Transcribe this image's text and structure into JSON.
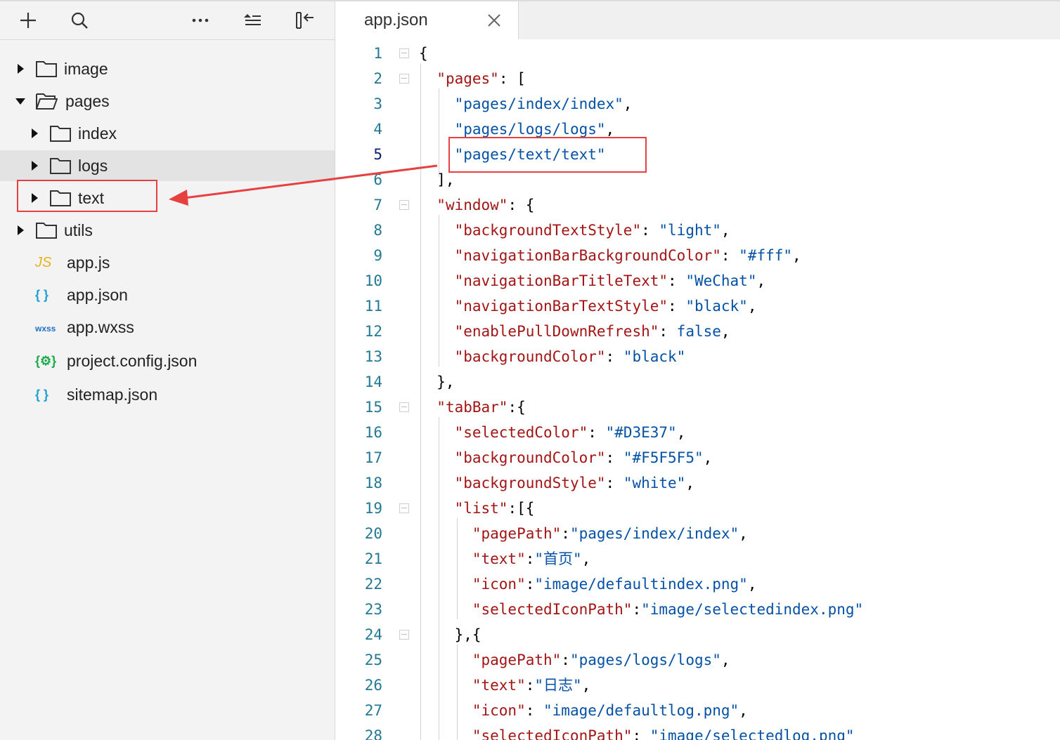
{
  "toolbar": {
    "icons": [
      "add-icon",
      "search-icon",
      "more-icon",
      "outline-icon",
      "collapse-icon"
    ]
  },
  "file_tree": [
    {
      "label": "image",
      "type": "folder",
      "expanded": false
    },
    {
      "label": "pages",
      "type": "folder",
      "expanded": true
    },
    {
      "label": "index",
      "type": "folder",
      "expanded": false
    },
    {
      "label": "logs",
      "type": "folder",
      "expanded": false,
      "selected": true
    },
    {
      "label": "text",
      "type": "folder",
      "expanded": false,
      "highlighted": true
    },
    {
      "label": "utils",
      "type": "folder",
      "expanded": false
    },
    {
      "label": "app.js",
      "type": "file",
      "badge": "JS",
      "badge_color": "#e8b21a"
    },
    {
      "label": "app.json",
      "type": "file",
      "badge": "{ }",
      "badge_color": "#1ea0d6"
    },
    {
      "label": "app.wxss",
      "type": "file",
      "badge": "wxss",
      "badge_color": "#1f6fc2"
    },
    {
      "label": "project.config.json",
      "type": "file",
      "badge": "{⚙}",
      "badge_color": "#1aab4a"
    },
    {
      "label": "sitemap.json",
      "type": "file",
      "badge": "{ }",
      "badge_color": "#1ea0d6"
    }
  ],
  "editor": {
    "tab_label": "app.json",
    "current_line": 5,
    "lines": [
      {
        "n": "1",
        "text": "{"
      },
      {
        "n": "2",
        "text": "  \"pages\": ["
      },
      {
        "n": "3",
        "text": "    \"pages/index/index\","
      },
      {
        "n": "4",
        "text": "    \"pages/logs/logs\","
      },
      {
        "n": "5",
        "text": "    \"pages/text/text\""
      },
      {
        "n": "6",
        "text": "  ],"
      },
      {
        "n": "7",
        "text": "  \"window\": {"
      },
      {
        "n": "8",
        "text": "    \"backgroundTextStyle\": \"light\","
      },
      {
        "n": "9",
        "text": "    \"navigationBarBackgroundColor\": \"#fff\","
      },
      {
        "n": "10",
        "text": "    \"navigationBarTitleText\": \"WeChat\","
      },
      {
        "n": "11",
        "text": "    \"navigationBarTextStyle\": \"black\","
      },
      {
        "n": "12",
        "text": "    \"enablePullDownRefresh\": false,"
      },
      {
        "n": "13",
        "text": "    \"backgroundColor\": \"black\""
      },
      {
        "n": "14",
        "text": "  },"
      },
      {
        "n": "15",
        "text": "  \"tabBar\":{"
      },
      {
        "n": "16",
        "text": "    \"selectedColor\": \"#D3E37\","
      },
      {
        "n": "17",
        "text": "    \"backgroundColor\": \"#F5F5F5\","
      },
      {
        "n": "18",
        "text": "    \"backgroundStyle\": \"white\","
      },
      {
        "n": "19",
        "text": "    \"list\":[{"
      },
      {
        "n": "20",
        "text": "      \"pagePath\":\"pages/index/index\","
      },
      {
        "n": "21",
        "text": "      \"text\":\"首页\","
      },
      {
        "n": "22",
        "text": "      \"icon\":\"image/defaultindex.png\","
      },
      {
        "n": "23",
        "text": "      \"selectedIconPath\":\"image/selectedindex.png\""
      },
      {
        "n": "24",
        "text": "    },{"
      },
      {
        "n": "25",
        "text": "      \"pagePath\":\"pages/logs/logs\","
      },
      {
        "n": "26",
        "text": "      \"text\":\"日志\","
      },
      {
        "n": "27",
        "text": "      \"icon\": \"image/defaultlog.png\","
      },
      {
        "n": "28",
        "text": "      \"selectedIconPath\": \"image/selectedlog.png\""
      }
    ],
    "fold_lines": [
      "1",
      "2",
      "7",
      "15",
      "19",
      "24"
    ]
  },
  "colors": {
    "highlight": "#e64040",
    "json_key": "#a31515",
    "json_string": "#0451a5",
    "line_number": "#237893"
  }
}
